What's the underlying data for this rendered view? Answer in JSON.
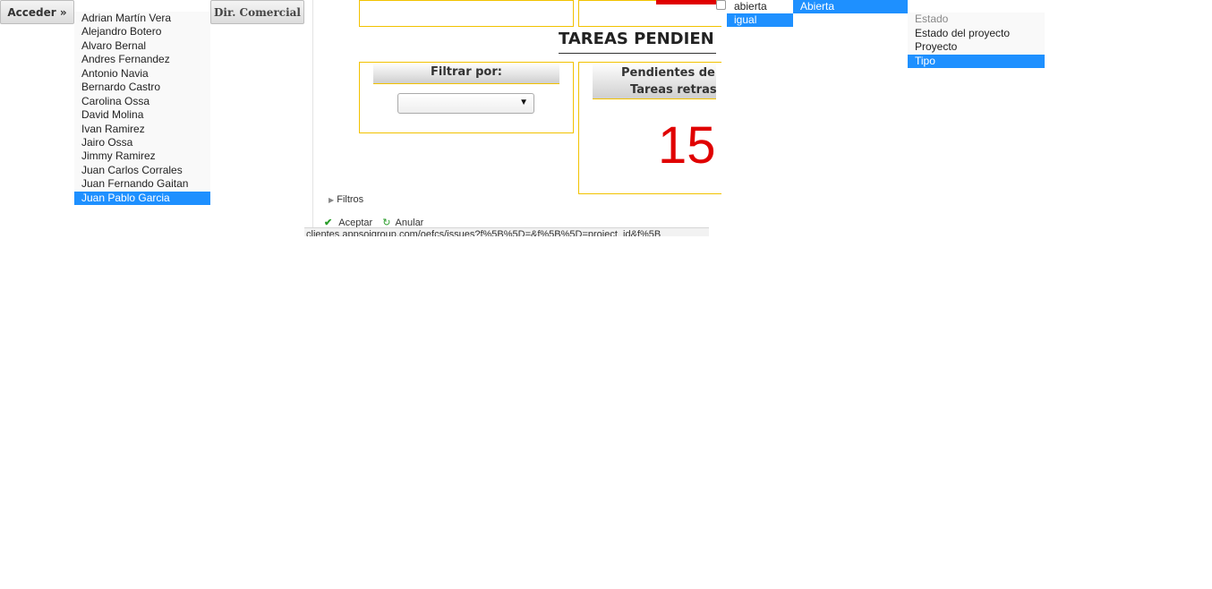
{
  "buttons": {
    "acceder": "Acceder »",
    "dir_comercial": "Dir. Comercial"
  },
  "users_dropdown": {
    "options": [
      "Adrian Martín Vera",
      "Alejandro Botero",
      "Alvaro Bernal",
      "Andres Fernandez",
      "Antonio Navia",
      "Bernardo Castro",
      "Carolina Ossa",
      "David Molina",
      "Ivan Ramirez",
      "Jairo Ossa",
      "Jimmy Ramirez",
      "Juan Carlos Corrales",
      "Juan Fernando Gaitan",
      "Juan Pablo Garcia"
    ],
    "selected": "Juan Pablo Garcia"
  },
  "main": {
    "section_title": "TAREAS PENDIEN",
    "filter_panel": {
      "title": "Filtrar por:",
      "select_value": ""
    },
    "pending_panel": {
      "title_line1": "Pendientes de ci",
      "title_line2": "Tareas retrasad",
      "count": "15"
    },
    "filtros_label": "Filtros",
    "accept_label": "Aceptar",
    "cancel_label": "Anular",
    "status_url": "clientes.appsoigroup.com/oefcs/issues?f%5B%5D=&f%5B%5D=project_id&f%5B"
  },
  "condition_dropdown": {
    "checkbox_label": "abierta",
    "selected_operator": "igual",
    "selected_value": "Abierta"
  },
  "fields_dropdown": {
    "options": [
      "Estado",
      "Estado del proyecto",
      "Proyecto",
      "Tipo"
    ],
    "muted": "Estado",
    "selected": "Tipo"
  },
  "colors": {
    "accent_blue": "#1e90ff",
    "panel_border": "#f2c200",
    "alert_red": "#e00000"
  },
  "icons": {
    "accept": "check-icon",
    "cancel": "refresh-icon",
    "filters_toggle": "triangle-right-icon",
    "select_arrow": "chevron-down-icon"
  }
}
